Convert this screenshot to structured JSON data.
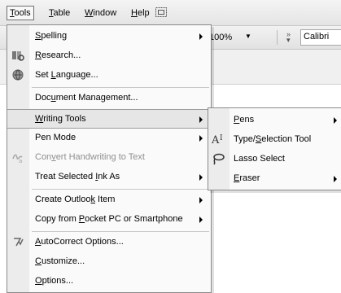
{
  "menubar": {
    "tools": "Tools",
    "table": "Table",
    "window": "Window",
    "help": "Help",
    "icon": "restore-window-icon"
  },
  "toolbar": {
    "zoom_value": "100%",
    "font_value": "Calibri"
  },
  "tools_menu": {
    "items": [
      {
        "label": "Spelling",
        "icon": "",
        "submenu": true
      },
      {
        "label": "Research...",
        "icon": "research-icon"
      },
      {
        "label": "Set Language...",
        "icon": "globe-icon"
      },
      {
        "label": "Document Management..."
      },
      {
        "label": "Writing Tools",
        "submenu": true,
        "highlighted": true
      },
      {
        "label": "Pen Mode",
        "submenu": true
      },
      {
        "label": "Convert Handwriting to Text",
        "icon": "convert-handwriting-icon",
        "disabled": true
      },
      {
        "label": "Treat Selected Ink As",
        "submenu": true
      },
      {
        "label": "Create Outlook Item",
        "submenu": true
      },
      {
        "label": "Copy from Pocket PC or Smartphone",
        "submenu": true
      },
      {
        "label": "AutoCorrect Options...",
        "icon": "autocorrect-icon"
      },
      {
        "label": "Customize..."
      },
      {
        "label": "Options..."
      }
    ]
  },
  "writing_tools_submenu": {
    "items": [
      {
        "label": "Pens",
        "submenu": true
      },
      {
        "label": "Type/Selection Tool",
        "icon": "type-selection-icon"
      },
      {
        "label": "Lasso Select",
        "icon": "lasso-icon"
      },
      {
        "label": "Eraser",
        "submenu": true
      }
    ]
  }
}
